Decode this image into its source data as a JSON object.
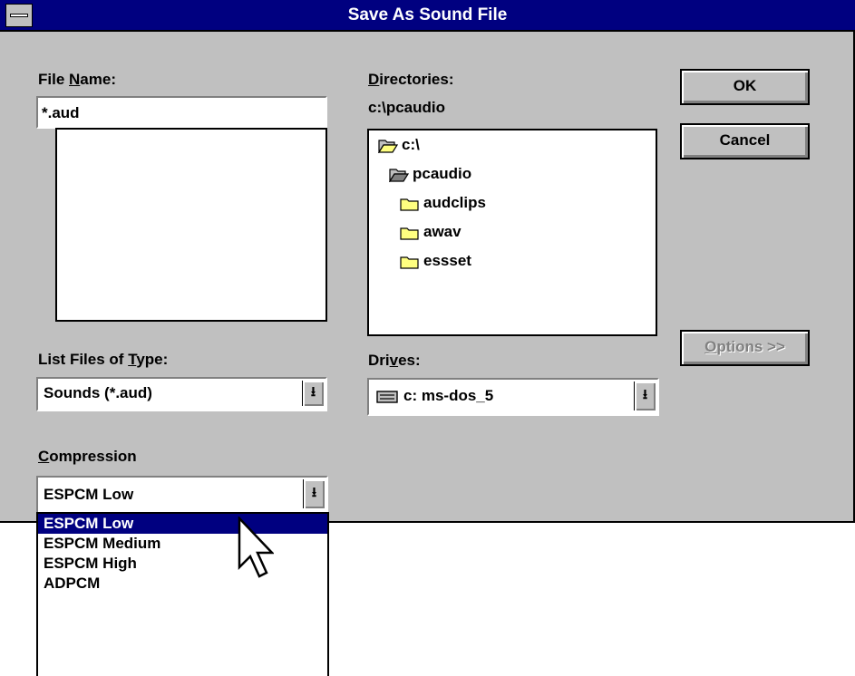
{
  "dialog": {
    "title": "Save As Sound File",
    "file_name": {
      "label_pre": "File ",
      "label_key": "N",
      "label_post": "ame:",
      "value": "*.aud"
    },
    "directories": {
      "label_pre": "",
      "label_key": "D",
      "label_post": "irectories:",
      "current": "c:\\pcaudio",
      "items": [
        "c:\\",
        "pcaudio",
        "audclips",
        "awav",
        "essset"
      ]
    },
    "file_type": {
      "label_pre": "List Files of ",
      "label_key": "T",
      "label_post": "ype:",
      "value": "Sounds (*.aud)"
    },
    "drives": {
      "label_pre": "Dri",
      "label_key": "v",
      "label_post": "es:",
      "value": "c: ms-dos_5"
    },
    "compression": {
      "label_pre": "",
      "label_key": "C",
      "label_post": "ompression",
      "value": "ESPCM Low",
      "options": [
        "ESPCM Low",
        "ESPCM Medium",
        "ESPCM High",
        "ADPCM"
      ]
    },
    "buttons": {
      "ok": "OK",
      "cancel": "Cancel",
      "options_key": "O",
      "options_rest": "ptions >>"
    }
  },
  "icons": {
    "dropdown": "dropdown-arrow-icon",
    "folder_open": "open-folder-icon",
    "folder": "folder-icon",
    "drive": "hard-drive-icon",
    "cursor": "mouse-pointer-icon"
  },
  "colors": {
    "titlebar": "#000080",
    "face": "#c0c0c0",
    "selection": "#000080",
    "folder": "#ffff80"
  }
}
